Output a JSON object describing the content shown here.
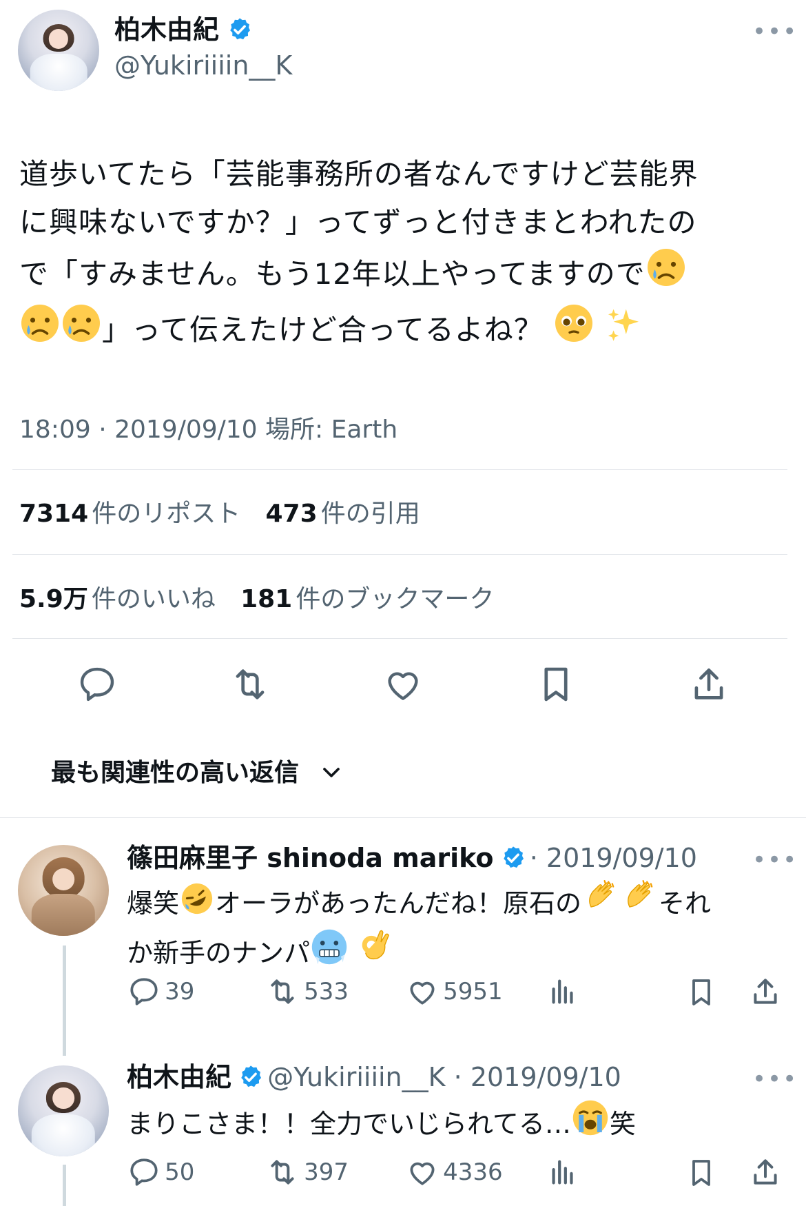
{
  "main_tweet": {
    "display_name": "柏木由紀",
    "handle": "@Yukiriiiin__K",
    "text_line1": "道歩いてたら「芸能事務所の者なんですけど芸能界",
    "text_line2": "に興味ないですか？」ってずっと付きまとわれたの",
    "text_line3": "で「すみません。もう12年以上やってますので",
    "text_line4": "」って伝えたけど合ってるよね？",
    "time": "18:09",
    "date": "2019/09/10",
    "location": "場所: Earth",
    "reposts_count": "7314",
    "reposts_label": "件のリポスト",
    "quotes_count": "473",
    "quotes_label": "件の引用",
    "likes_count": "5.9万",
    "likes_label": "件のいいね",
    "bookmarks_count": "181",
    "bookmarks_label": "件のブックマーク"
  },
  "sort": {
    "label": "最も関連性の高い返信"
  },
  "replies": [
    {
      "display_name": "篠田麻里子 shinoda mariko",
      "date": "2019/09/10",
      "text_a": "爆笑",
      "text_b": "オーラがあったんだね！原石の",
      "text_c": "それ",
      "text_d": "か新手のナンパ",
      "reply_count": "39",
      "repost_count": "533",
      "like_count": "5951"
    },
    {
      "display_name": "柏木由紀",
      "handle": "@Yukiriiiin__K",
      "date": "2019/09/10",
      "text_a": "まりこさま！！全力でいじられてる…",
      "text_b": "笑",
      "reply_count": "50",
      "repost_count": "397",
      "like_count": "4336"
    }
  ],
  "colors": {
    "verified": "#1d9bf0",
    "secondary": "#536471",
    "divider": "#e3e6ea"
  }
}
